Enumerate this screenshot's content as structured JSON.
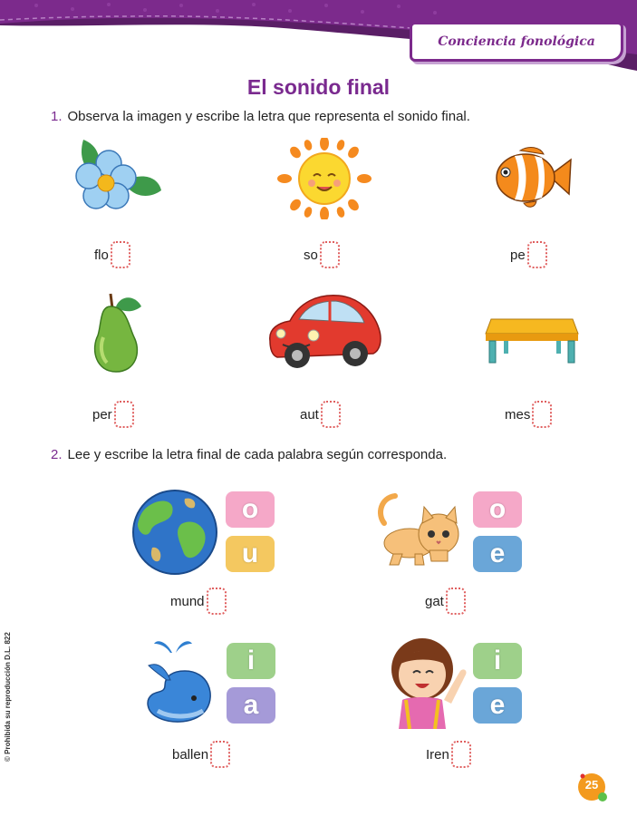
{
  "header": {
    "tag_label": "Conciencia fonológica"
  },
  "page_title": "El sonido final",
  "ex1": {
    "number": "1.",
    "instruction": "Observa la imagen y escribe la letra que representa el sonido final.",
    "items": [
      {
        "word": "flo",
        "icon": "flower-icon"
      },
      {
        "word": "so",
        "icon": "sun-icon"
      },
      {
        "word": "pe",
        "icon": "fish-icon"
      },
      {
        "word": "per",
        "icon": "pear-icon"
      },
      {
        "word": "aut",
        "icon": "car-icon"
      },
      {
        "word": "mes",
        "icon": "table-icon"
      }
    ]
  },
  "ex2": {
    "number": "2.",
    "instruction": "Lee y escribe la letra final de cada palabra según corresponda.",
    "items": [
      {
        "word": "mund",
        "icon": "earth-icon",
        "options": [
          "o",
          "u"
        ]
      },
      {
        "word": "gat",
        "icon": "cat-icon",
        "options": [
          "o",
          "e"
        ]
      },
      {
        "word": "ballen",
        "icon": "whale-icon",
        "options": [
          "i",
          "a"
        ]
      },
      {
        "word": "Iren",
        "icon": "girl-icon",
        "options": [
          "i",
          "e"
        ]
      }
    ]
  },
  "footer": {
    "copyright": "© Prohibida su reproducción D.L. 822",
    "page_number": "25"
  },
  "colors": {
    "accent": "#7a2a8f",
    "blank_border": "#e06060",
    "tile_pink": "#f5a8c8",
    "tile_yellow": "#f4c860",
    "tile_blue": "#6aa6d8",
    "tile_green": "#9ed08a",
    "tile_lilac": "#a59ad8",
    "page_badge": "#f39a1e"
  }
}
